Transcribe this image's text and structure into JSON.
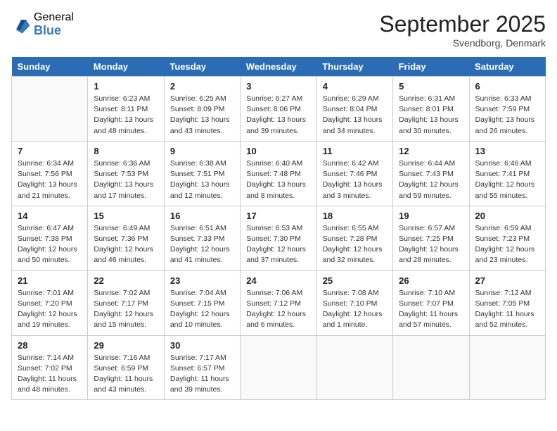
{
  "logo": {
    "general": "General",
    "blue": "Blue"
  },
  "header": {
    "month": "September 2025",
    "location": "Svendborg, Denmark"
  },
  "days_of_week": [
    "Sunday",
    "Monday",
    "Tuesday",
    "Wednesday",
    "Thursday",
    "Friday",
    "Saturday"
  ],
  "weeks": [
    [
      {
        "num": "",
        "info": ""
      },
      {
        "num": "1",
        "info": "Sunrise: 6:23 AM\nSunset: 8:11 PM\nDaylight: 13 hours and 48 minutes."
      },
      {
        "num": "2",
        "info": "Sunrise: 6:25 AM\nSunset: 8:09 PM\nDaylight: 13 hours and 43 minutes."
      },
      {
        "num": "3",
        "info": "Sunrise: 6:27 AM\nSunset: 8:06 PM\nDaylight: 13 hours and 39 minutes."
      },
      {
        "num": "4",
        "info": "Sunrise: 6:29 AM\nSunset: 8:04 PM\nDaylight: 13 hours and 34 minutes."
      },
      {
        "num": "5",
        "info": "Sunrise: 6:31 AM\nSunset: 8:01 PM\nDaylight: 13 hours and 30 minutes."
      },
      {
        "num": "6",
        "info": "Sunrise: 6:33 AM\nSunset: 7:59 PM\nDaylight: 13 hours and 26 minutes."
      }
    ],
    [
      {
        "num": "7",
        "info": "Sunrise: 6:34 AM\nSunset: 7:56 PM\nDaylight: 13 hours and 21 minutes."
      },
      {
        "num": "8",
        "info": "Sunrise: 6:36 AM\nSunset: 7:53 PM\nDaylight: 13 hours and 17 minutes."
      },
      {
        "num": "9",
        "info": "Sunrise: 6:38 AM\nSunset: 7:51 PM\nDaylight: 13 hours and 12 minutes."
      },
      {
        "num": "10",
        "info": "Sunrise: 6:40 AM\nSunset: 7:48 PM\nDaylight: 13 hours and 8 minutes."
      },
      {
        "num": "11",
        "info": "Sunrise: 6:42 AM\nSunset: 7:46 PM\nDaylight: 13 hours and 3 minutes."
      },
      {
        "num": "12",
        "info": "Sunrise: 6:44 AM\nSunset: 7:43 PM\nDaylight: 12 hours and 59 minutes."
      },
      {
        "num": "13",
        "info": "Sunrise: 6:46 AM\nSunset: 7:41 PM\nDaylight: 12 hours and 55 minutes."
      }
    ],
    [
      {
        "num": "14",
        "info": "Sunrise: 6:47 AM\nSunset: 7:38 PM\nDaylight: 12 hours and 50 minutes."
      },
      {
        "num": "15",
        "info": "Sunrise: 6:49 AM\nSunset: 7:36 PM\nDaylight: 12 hours and 46 minutes."
      },
      {
        "num": "16",
        "info": "Sunrise: 6:51 AM\nSunset: 7:33 PM\nDaylight: 12 hours and 41 minutes."
      },
      {
        "num": "17",
        "info": "Sunrise: 6:53 AM\nSunset: 7:30 PM\nDaylight: 12 hours and 37 minutes."
      },
      {
        "num": "18",
        "info": "Sunrise: 6:55 AM\nSunset: 7:28 PM\nDaylight: 12 hours and 32 minutes."
      },
      {
        "num": "19",
        "info": "Sunrise: 6:57 AM\nSunset: 7:25 PM\nDaylight: 12 hours and 28 minutes."
      },
      {
        "num": "20",
        "info": "Sunrise: 6:59 AM\nSunset: 7:23 PM\nDaylight: 12 hours and 23 minutes."
      }
    ],
    [
      {
        "num": "21",
        "info": "Sunrise: 7:01 AM\nSunset: 7:20 PM\nDaylight: 12 hours and 19 minutes."
      },
      {
        "num": "22",
        "info": "Sunrise: 7:02 AM\nSunset: 7:17 PM\nDaylight: 12 hours and 15 minutes."
      },
      {
        "num": "23",
        "info": "Sunrise: 7:04 AM\nSunset: 7:15 PM\nDaylight: 12 hours and 10 minutes."
      },
      {
        "num": "24",
        "info": "Sunrise: 7:06 AM\nSunset: 7:12 PM\nDaylight: 12 hours and 6 minutes."
      },
      {
        "num": "25",
        "info": "Sunrise: 7:08 AM\nSunset: 7:10 PM\nDaylight: 12 hours and 1 minute."
      },
      {
        "num": "26",
        "info": "Sunrise: 7:10 AM\nSunset: 7:07 PM\nDaylight: 11 hours and 57 minutes."
      },
      {
        "num": "27",
        "info": "Sunrise: 7:12 AM\nSunset: 7:05 PM\nDaylight: 11 hours and 52 minutes."
      }
    ],
    [
      {
        "num": "28",
        "info": "Sunrise: 7:14 AM\nSunset: 7:02 PM\nDaylight: 11 hours and 48 minutes."
      },
      {
        "num": "29",
        "info": "Sunrise: 7:16 AM\nSunset: 6:59 PM\nDaylight: 11 hours and 43 minutes."
      },
      {
        "num": "30",
        "info": "Sunrise: 7:17 AM\nSunset: 6:57 PM\nDaylight: 11 hours and 39 minutes."
      },
      {
        "num": "",
        "info": ""
      },
      {
        "num": "",
        "info": ""
      },
      {
        "num": "",
        "info": ""
      },
      {
        "num": "",
        "info": ""
      }
    ]
  ]
}
